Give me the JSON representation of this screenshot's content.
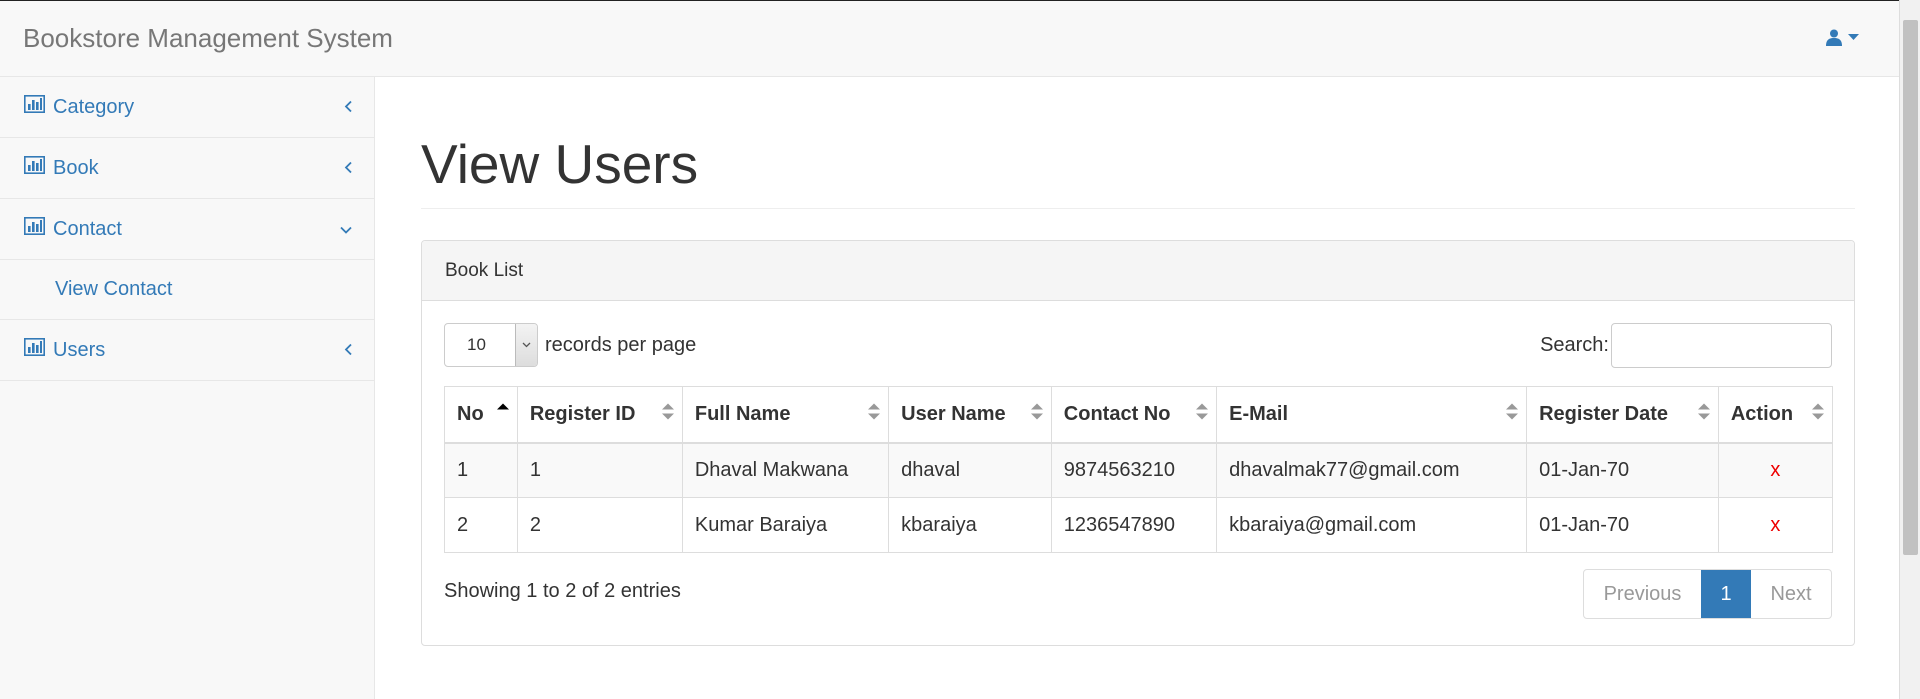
{
  "app": {
    "title": "Bookstore Management System"
  },
  "header": {
    "user_icon": "user-icon",
    "caret_icon": "caret-down-icon"
  },
  "sidebar": {
    "items": [
      {
        "label": "Category",
        "icon": "bar-chart-icon",
        "chevron": "chevron-left-icon"
      },
      {
        "label": "Book",
        "icon": "bar-chart-icon",
        "chevron": "chevron-left-icon"
      },
      {
        "label": "Contact",
        "icon": "bar-chart-icon",
        "chevron": "chevron-down-icon",
        "sub": [
          {
            "label": "View Contact"
          }
        ]
      },
      {
        "label": "Users",
        "icon": "bar-chart-icon",
        "chevron": "chevron-left-icon"
      }
    ]
  },
  "main": {
    "title": "View Users",
    "panel": {
      "heading": "Book List",
      "length": {
        "value": "10",
        "suffix": "records per page"
      },
      "search": {
        "label": "Search:",
        "value": ""
      },
      "table": {
        "columns": [
          "No",
          "Register ID",
          "Full Name",
          "User Name",
          "Contact No",
          "E-Mail",
          "Register Date",
          "Action"
        ],
        "rows": [
          [
            "1",
            "1",
            "Dhaval Makwana",
            "dhaval",
            "9874563210",
            "dhavalmak77@gmail.com",
            "01-Jan-70",
            "x"
          ],
          [
            "2",
            "2",
            "Kumar Baraiya",
            "kbaraiya",
            "1236547890",
            "kbaraiya@gmail.com",
            "01-Jan-70",
            "x"
          ]
        ]
      },
      "info": "Showing 1 to 2 of 2 entries",
      "pagination": {
        "previous": "Previous",
        "current": "1",
        "next": "Next"
      }
    }
  },
  "colors": {
    "link": "#337ab7",
    "delete": "#ee0000",
    "active_page": "#337ab7"
  }
}
